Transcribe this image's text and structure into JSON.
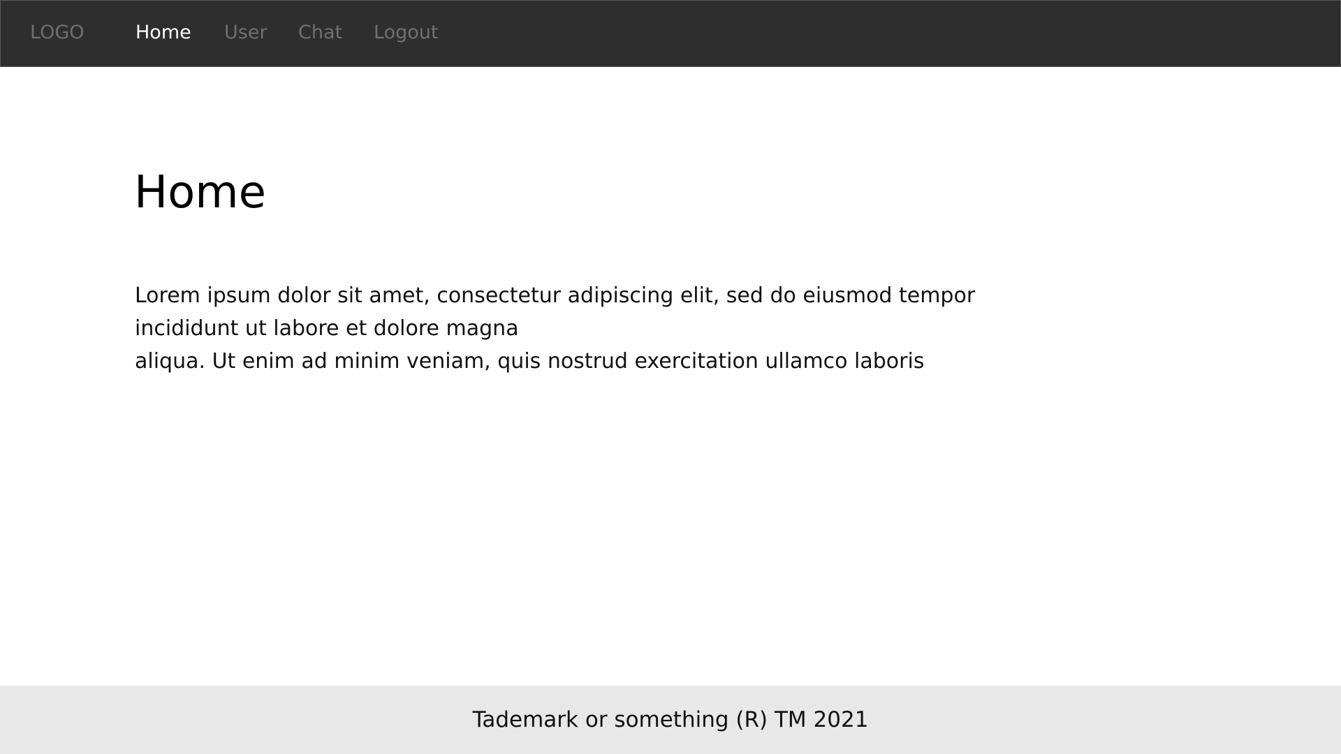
{
  "nav": {
    "logo": "LOGO",
    "items": [
      {
        "label": "Home",
        "active": true
      },
      {
        "label": "User",
        "active": false
      },
      {
        "label": "Chat",
        "active": false
      },
      {
        "label": "Logout",
        "active": false
      }
    ]
  },
  "main": {
    "title": "Home",
    "lines": [
      "Lorem ipsum dolor sit amet, consectetur adipiscing elit, sed do eiusmod tempor",
      "incididunt ut labore et dolore magna",
      "aliqua. Ut enim ad minim veniam, quis nostrud exercitation ullamco laboris"
    ]
  },
  "footer": {
    "text": "Tademark or something (R) TM 2021"
  },
  "colors": {
    "navbar": "#2e2e2e",
    "nav_inactive": "#6f6f6f",
    "nav_active": "#ffffff",
    "footer": "#e8e8e8"
  }
}
